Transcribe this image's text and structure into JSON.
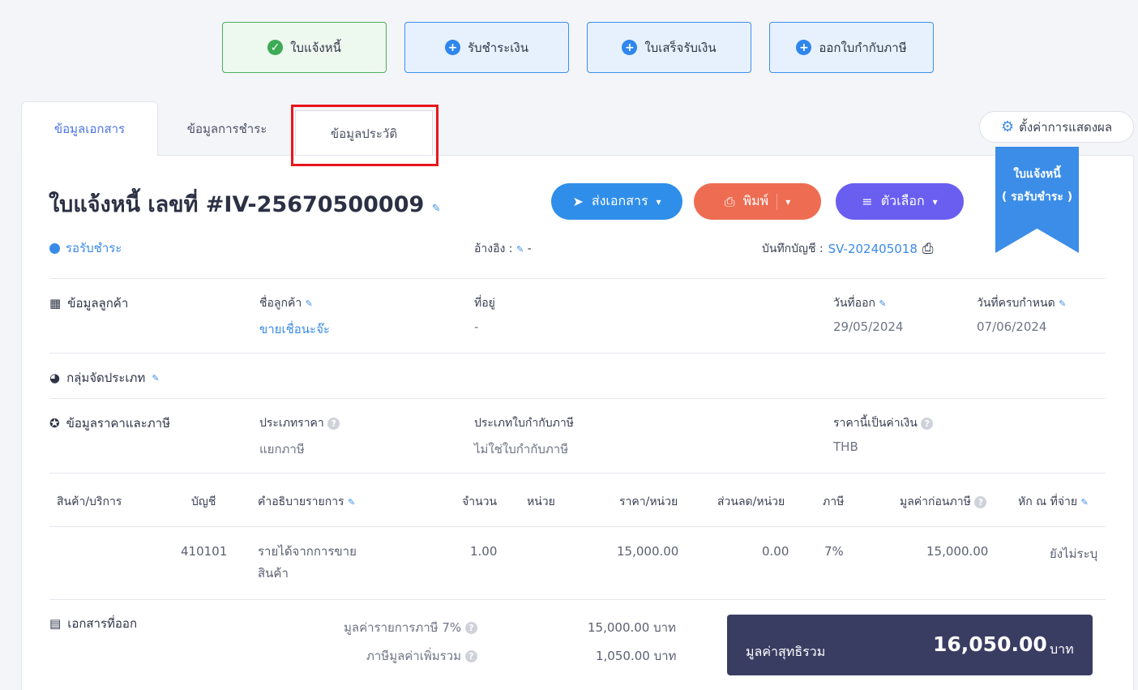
{
  "steps": [
    {
      "label": "ใบแจ้งหนี้",
      "icon": "check-circle-icon"
    },
    {
      "label": "รับชำระเงิน",
      "icon": "plus-circle-icon"
    },
    {
      "label": "ใบเสร็จรับเงิน",
      "icon": "plus-circle-icon"
    },
    {
      "label": "ออกใบกำกับภาษี",
      "icon": "plus-circle-icon"
    }
  ],
  "tabs": [
    {
      "label": "ข้อมูลเอกสาร"
    },
    {
      "label": "ข้อมูลการชำระ"
    },
    {
      "label": "ข้อมูลประวัติ"
    }
  ],
  "settings": {
    "label": "ตั้งค่าการแสดงผล"
  },
  "ribbon": {
    "line1": "ใบแจ้งหนี้",
    "line2": "( รอรับชำระ )"
  },
  "doc": {
    "title": "ใบแจ้งหนี้ เลขที่ #IV-25670500009"
  },
  "actions": {
    "send": "ส่งเอกสาร",
    "print": "พิมพ์",
    "options": "ตัวเลือก"
  },
  "status": {
    "label": "รอรับชำระ",
    "color": "#3a8ae8"
  },
  "reference": {
    "label": "อ้างอิง :",
    "value": "-"
  },
  "account": {
    "label": "บันทึกบัญชี :",
    "value": "SV-202405018"
  },
  "customer": {
    "section": "ข้อมูลลูกค้า",
    "name_label": "ชื่อลูกค้า",
    "name_value": "ขายเชื่อนะจ๊ะ",
    "address_label": "ที่อยู่",
    "address_value": "-",
    "issue_label": "วันที่ออก",
    "issue_value": "29/05/2024",
    "due_label": "วันที่ครบกำหนด",
    "due_value": "07/06/2024"
  },
  "group": {
    "section": "กลุ่มจัดประเภท"
  },
  "pricing": {
    "section": "ข้อมูลราคาและภาษี",
    "price_type_label": "ประเภทราคา",
    "price_type_value": "แยกภาษี",
    "tax_invoice_label": "ประเภทใบกำกับภาษี",
    "tax_invoice_value": "ไม่ใช่ใบกำกับภาษี",
    "currency_label": "ราคานี้เป็นค่าเงิน",
    "currency_value": "THB"
  },
  "table": {
    "headers": [
      "สินค้า/บริการ",
      "บัญชี",
      "คำอธิบายรายการ",
      "จำนวน",
      "หน่วย",
      "ราคา/หน่วย",
      "ส่วนลด/หน่วย",
      "ภาษี",
      "มูลค่าก่อนภาษี",
      "หัก ณ ที่จ่าย"
    ],
    "rows": [
      {
        "product": "",
        "account": "410101",
        "desc1": "รายได้จากการขาย",
        "desc2": "สินค้า",
        "qty": "1.00",
        "unit": "",
        "price": "15,000.00",
        "discount": "0.00",
        "tax": "7%",
        "pretax": "15,000.00",
        "wht": "ยังไม่ระบุ"
      }
    ]
  },
  "issued": {
    "section": "เอกสารที่ออก"
  },
  "summary": {
    "taxable_label": "มูลค่ารายการภาษี 7%",
    "taxable_value": "15,000.00 บาท",
    "vat_label": "ภาษีมูลค่าเพิ่มรวม",
    "vat_value": "1,050.00 บาท",
    "net_label": "มูลค่าสุทธิรวม",
    "net_value": "16,050.00",
    "net_unit": "บาท"
  }
}
